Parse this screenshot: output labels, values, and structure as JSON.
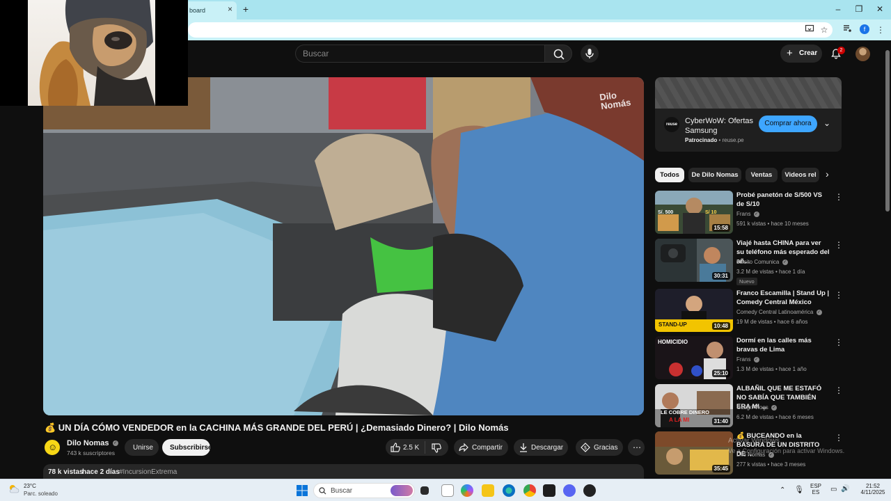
{
  "browser": {
    "tab_title": "board",
    "tab_close": "×",
    "new_tab": "+",
    "profile_initial": "f"
  },
  "header": {
    "search_placeholder": "Buscar",
    "create_label": "Crear",
    "notification_count": "2"
  },
  "video": {
    "title": "💰 UN DÍA CÓMO VENDEDOR en la CACHINA MÁS GRANDE DEL PERÚ | ¿Demasiado Dinero? | Dilo Nomás",
    "watermark": "Dilo Nomás",
    "channel_name": "Dilo Nomas",
    "subscribers": "743 k suscriptores",
    "join_label": "Unirse",
    "subscribe_label": "Subscribirse",
    "likes": "2.5 K",
    "share_label": "Compartir",
    "download_label": "Descargar",
    "thanks_label": "Gracias",
    "views": "78 k vistas",
    "date": "hace 2 días",
    "hashtag": "#IncursionExtrema"
  },
  "ad": {
    "logo_text": "reuse",
    "title": "CyberWoW: Ofertas Samsung",
    "sponsored": "Patrocinado",
    "domain": "reuse.pe",
    "cta": "Comprar ahora"
  },
  "chips": [
    "Todos",
    "De Dilo Nomas",
    "Ventas",
    "Videos rel"
  ],
  "recommendations": [
    {
      "title": "Probé panetón de S/500 VS de S/10",
      "channel": "Frans",
      "meta": "591 k vistas • hace 10 meses",
      "duration": "15:58",
      "thumb_text_a": "S/. 500",
      "thumb_text_b": "S/ 10"
    },
    {
      "title": "Viajé hasta CHINA para ver su teléfono más esperado del añ...",
      "channel": "Luisito Comunica",
      "meta": "3.2 M de vistas • hace 1 día",
      "duration": "30:31",
      "badge": "Nuevo"
    },
    {
      "title": "Franco Escamilla | Stand Up | Comedy Central México",
      "channel": "Comedy Central Latinoamérica",
      "meta": "19 M de vistas • hace 6 años",
      "duration": "10:48",
      "thumb_text_a": "STAND-UP"
    },
    {
      "title": "Dormí en las calles más bravas de Lima",
      "channel": "Frans",
      "meta": "1.3 M de vistas • hace 1 año",
      "duration": "25:10",
      "thumb_text_a": "HOMICIDIO"
    },
    {
      "title": "ALBAÑIL QUE ME ESTAFÓ NO SABÍA QUE TAMBIÉN ERA MI ...",
      "channel": "Gusgri Vlogs",
      "meta": "6.2 M de vistas • hace 6 meses",
      "duration": "31:40",
      "thumb_text_a": "LE COBRE DINERO",
      "thumb_text_b": "A LA MI"
    },
    {
      "title": "💰 BUCEANDO en la BASURA DE UN DISTRITO DE ...",
      "channel": "Dilo Nomas",
      "meta": "277 k vistas • hace 3 meses",
      "duration": "35:45"
    }
  ],
  "watermark_os": {
    "line1": "Activar Windows",
    "line2": "Ve a Configuración para activar Windows."
  },
  "taskbar": {
    "temperature": "23°C",
    "weather": "Parc. soleado",
    "search_label": "Buscar",
    "lang_top": "ESP",
    "lang_bottom": "ES",
    "time": "21:52",
    "date": "4/11/2025"
  }
}
